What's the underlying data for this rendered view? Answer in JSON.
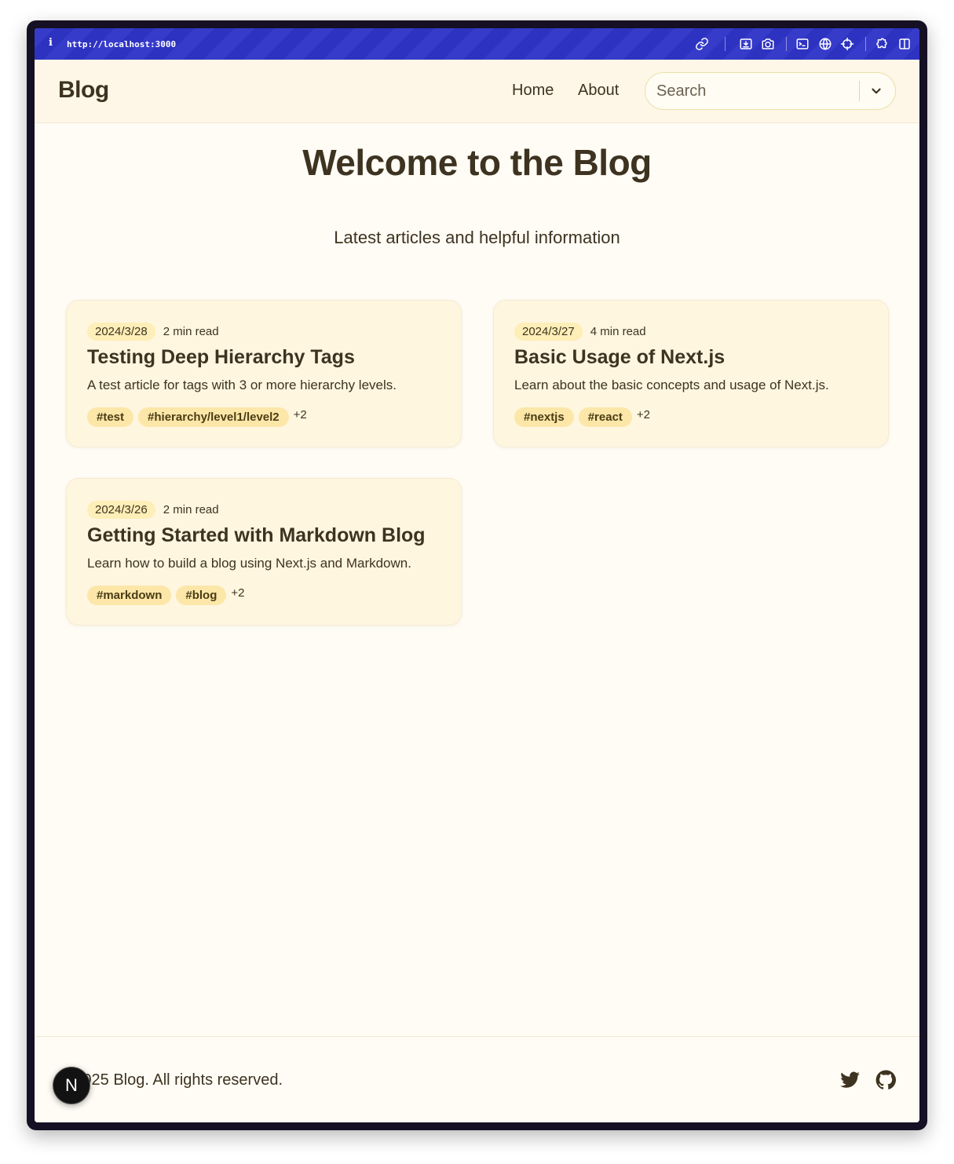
{
  "browser": {
    "info_glyph": "i",
    "url": "http://localhost:3000",
    "toolbar_icons": [
      "link-icon",
      "download-icon",
      "camera-icon",
      "terminal-icon",
      "globe-icon",
      "crosshair-icon",
      "extension-icon",
      "split-view-icon"
    ]
  },
  "header": {
    "logo": "Blog",
    "nav": [
      {
        "label": "Home"
      },
      {
        "label": "About"
      }
    ],
    "search": {
      "placeholder": "Search",
      "value": ""
    }
  },
  "hero": {
    "title": "Welcome to the Blog",
    "subtitle": "Latest articles and helpful information"
  },
  "posts": [
    {
      "date": "2024/3/28",
      "read_time": "2 min read",
      "title": "Testing Deep Hierarchy Tags",
      "description": "A test article for tags with 3 or more hierarchy levels.",
      "tags": [
        "#test",
        "#hierarchy/level1/level2"
      ],
      "more_tags": "+2"
    },
    {
      "date": "2024/3/27",
      "read_time": "4 min read",
      "title": "Basic Usage of Next.js",
      "description": "Learn about the basic concepts and usage of Next.js.",
      "tags": [
        "#nextjs",
        "#react"
      ],
      "more_tags": "+2"
    },
    {
      "date": "2024/3/26",
      "read_time": "2 min read",
      "title": "Getting Started with Markdown Blog",
      "description": "Learn how to build a blog using Next.js and Markdown.",
      "tags": [
        "#markdown",
        "#blog"
      ],
      "more_tags": "+2"
    }
  ],
  "footer": {
    "copyright": "© 2025 Blog. All rights reserved.",
    "social_icons": [
      "twitter-icon",
      "github-icon"
    ]
  },
  "dev_badge": {
    "label": "N"
  },
  "colors": {
    "browser_toolbar": "#2f34c8",
    "page_background": "#fffcf5",
    "header_background": "#fef7e8",
    "card_background": "#fff6e0",
    "tag_background": "#fce7a8",
    "text": "#3d3320"
  }
}
